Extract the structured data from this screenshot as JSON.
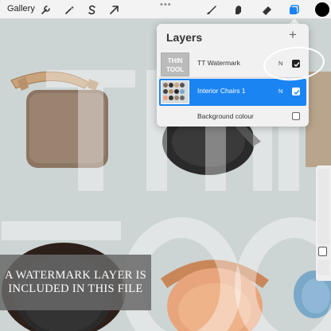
{
  "toolbar": {
    "gallery_label": "Gallery",
    "left_icons": [
      "wrench-icon",
      "magic-wand-icon",
      "selection-s-icon",
      "transform-arrow-icon"
    ],
    "right_icons": [
      "brush-icon",
      "smudge-icon",
      "eraser-icon",
      "layers-icon"
    ],
    "more_dots": "•••",
    "active_color": "#000000",
    "active_tool_color": "#1a84f3"
  },
  "watermark_letters": {
    "top": "THIN",
    "bottom": "TOO"
  },
  "layers_panel": {
    "title": "Layers",
    "add_button": "+",
    "layers": [
      {
        "name": "TT Watermark",
        "thumbnail_text": "THIN TOOL",
        "blend_mode": "N",
        "visible": true,
        "selected": false
      },
      {
        "name": "Interior Chairs 1",
        "blend_mode": "N",
        "visible": true,
        "selected": true
      }
    ],
    "background": {
      "label": "Background colour",
      "visible": false
    }
  },
  "caption": {
    "text": "A WATERMARK LAYER IS INCLUDED IN THIS FILE"
  },
  "colors": {
    "accent": "#1a84f3",
    "canvas_bg": "#cdd4d4",
    "caption_bg": "#696969"
  }
}
